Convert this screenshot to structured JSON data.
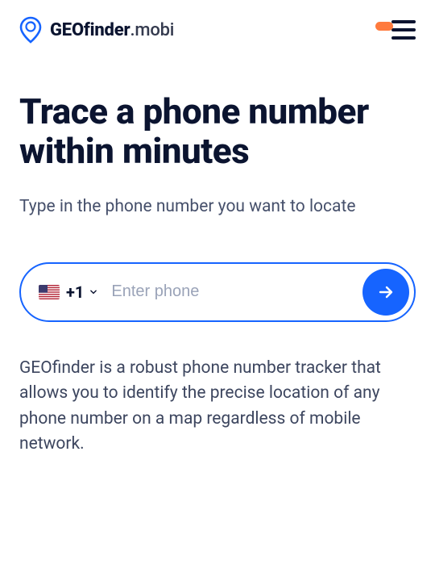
{
  "header": {
    "brand_bold": "GEOfinder",
    "brand_light": ".mobi"
  },
  "hero": {
    "title": "Trace a phone number within minutes",
    "subtitle": "Type in the phone number you want to locate"
  },
  "phone_form": {
    "country_code": "+1",
    "placeholder": "Enter phone",
    "value": ""
  },
  "description": "GEOfinder is a robust phone number tracker that allows you to identify the precise location of any phone number on a map regardless of mobile network."
}
